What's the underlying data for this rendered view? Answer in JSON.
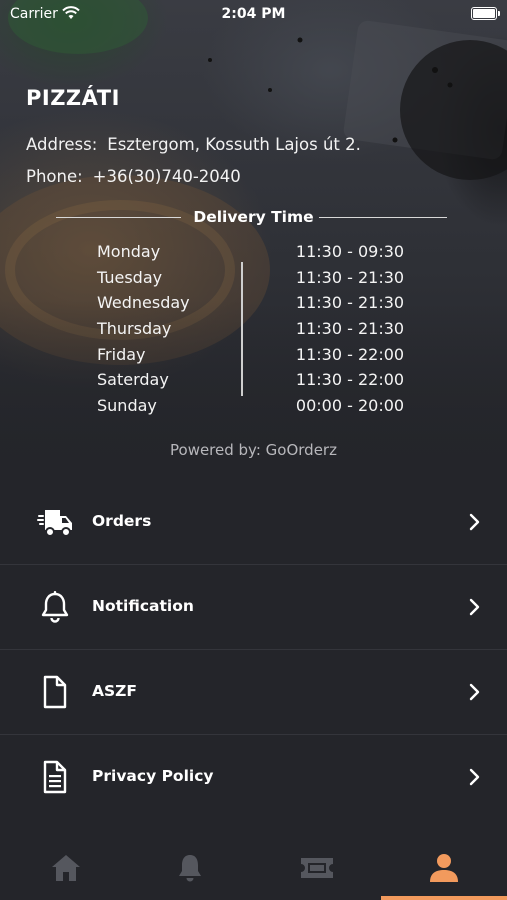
{
  "status_bar": {
    "carrier": "Carrier",
    "time": "2:04 PM"
  },
  "restaurant": {
    "name": "PIZZÁTI",
    "address_label": "Address:",
    "address": "Esztergom, Kossuth Lajos út 2.",
    "phone_label": "Phone:",
    "phone": "+36(30)740-2040"
  },
  "delivery": {
    "title": "Delivery Time",
    "schedule": [
      {
        "day": "Monday",
        "hours": "11:30 - 09:30"
      },
      {
        "day": "Tuesday",
        "hours": "11:30 - 21:30"
      },
      {
        "day": "Wednesday",
        "hours": "11:30 - 21:30"
      },
      {
        "day": "Thursday",
        "hours": "11:30 - 21:30"
      },
      {
        "day": "Friday",
        "hours": "11:30 - 22:00"
      },
      {
        "day": "Saterday",
        "hours": "11:30 - 22:00"
      },
      {
        "day": "Sunday",
        "hours": "00:00 - 20:00"
      }
    ]
  },
  "powered_by": "Powered by: GoOrderz",
  "menu": [
    {
      "label": "Orders",
      "icon": "delivery-truck-icon"
    },
    {
      "label": "Notification",
      "icon": "bell-icon"
    },
    {
      "label": "ASZF",
      "icon": "document-icon"
    },
    {
      "label": "Privacy Policy",
      "icon": "document-lines-icon"
    }
  ],
  "tabs": [
    {
      "icon": "home-icon",
      "active": false
    },
    {
      "icon": "bell-icon",
      "active": false
    },
    {
      "icon": "ticket-icon",
      "active": false
    },
    {
      "icon": "user-icon",
      "active": true
    }
  ],
  "colors": {
    "background": "#24252a",
    "accent": "#f29a5d",
    "inactive_icon": "#55575e",
    "divider": "#34353b"
  }
}
